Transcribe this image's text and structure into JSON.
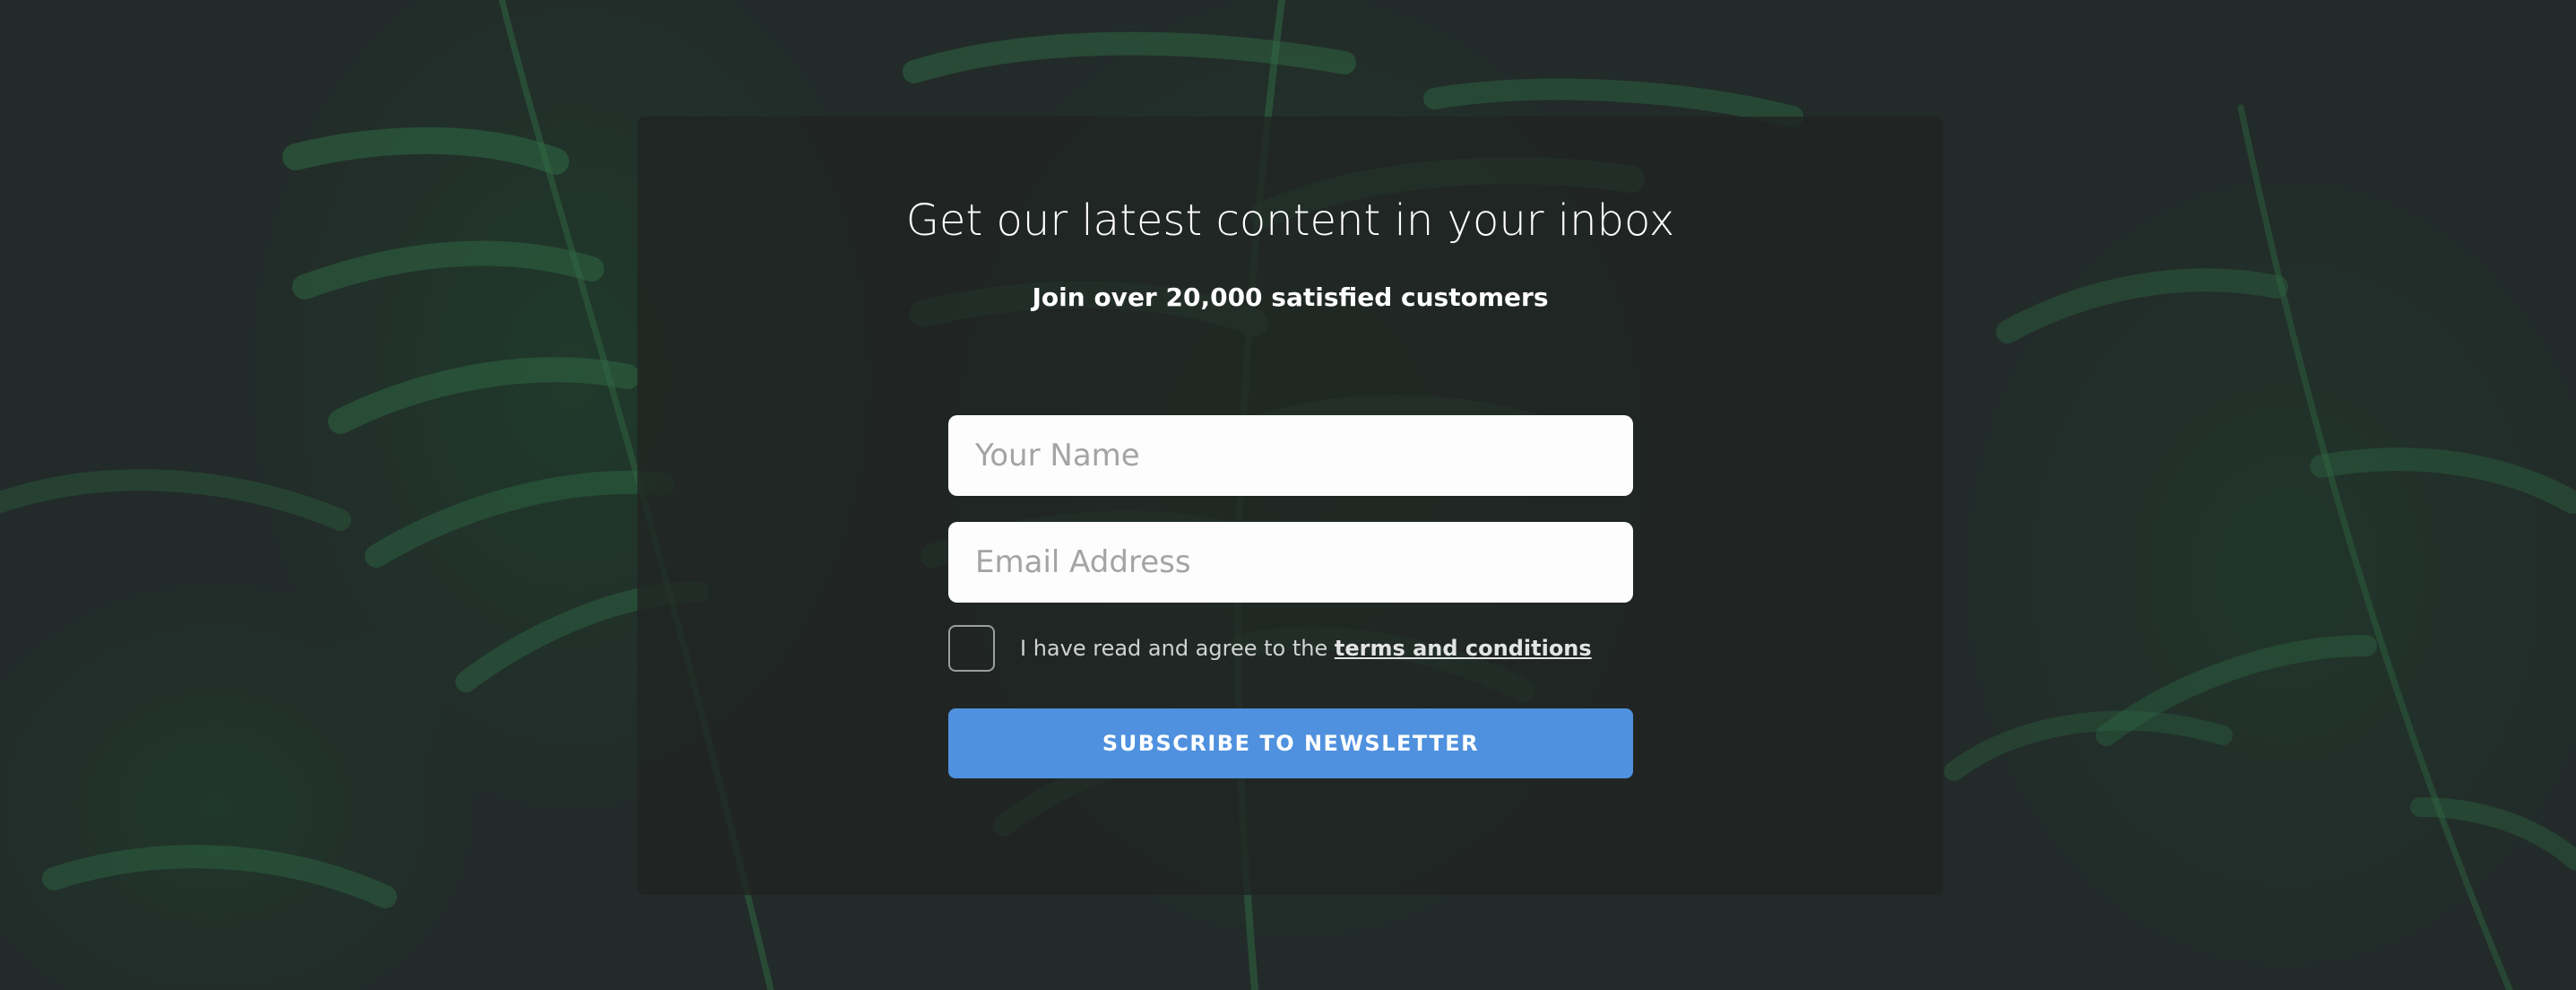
{
  "signup": {
    "title": "Get our latest content in your inbox",
    "subtitle": "Join over 20,000 satisfied customers",
    "name_placeholder": "Your Name",
    "email_placeholder": "Email Address",
    "consent_text": "I have read and agree to the ",
    "terms_link": "terms and conditions",
    "consent_checked": false,
    "subscribe_label": "SUBSCRIBE TO NEWSLETTER"
  },
  "colors": {
    "background": "#222b29",
    "panel": "#202423",
    "button": "#4f91de",
    "input": "#fdfdfd"
  }
}
